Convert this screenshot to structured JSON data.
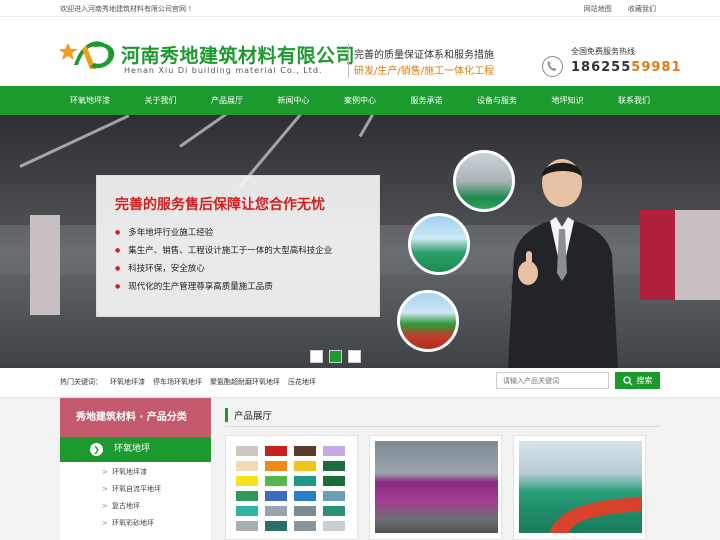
{
  "topbar": {
    "welcome": "欢迎进入河南秀地建筑材料有限公司官网 ！",
    "links": [
      "网站地图",
      "收藏我们"
    ]
  },
  "header": {
    "company_cn": "河南秀地建筑材料有限公司",
    "company_en": "Henan Xiu Di building material Co., Ltd.",
    "slogan_line1": "完善的质量保证体系和服务措施",
    "slogan_line2": "研发/生产/销售/施工一体化工程",
    "hotline_label": "全国免费服务热线",
    "hotline_main": "186255",
    "hotline_highlight": "59981"
  },
  "nav": {
    "items": [
      "环氧地坪漆",
      "关于我们",
      "产品展厅",
      "新闻中心",
      "案例中心",
      "服务承诺",
      "设备与服务",
      "地坪知识",
      "联系我们"
    ]
  },
  "banner": {
    "headline": "完善的服务售后保障让您合作无忧",
    "points": [
      "多年地坪行业施工经验",
      "集生产、销售、工程设计施工于一体的大型高科技企业",
      "科技环保，安全放心",
      "现代化的生产管理尊享高质量施工品质"
    ],
    "slide_count": 3,
    "active_slide": 2
  },
  "search": {
    "keywords_label": "热门关键词：",
    "keywords": [
      "环氧地坪漆",
      "停车场环氧地坪",
      "聚氨酯超耐磨环氧地坪",
      "压花地坪"
    ],
    "placeholder": "请输入产品关键词",
    "button_label": "搜索"
  },
  "sidebar": {
    "title": "秀地建筑材料 · 产品分类",
    "category": "环氧地坪",
    "items": [
      "环氧地坪漆",
      "环氧自流平地坪",
      "复古地坪",
      "环氧彩砂地坪"
    ]
  },
  "products": {
    "section_title": "产品展厅",
    "swatch_colors": [
      "#cfc7bf",
      "#c7201f",
      "#5b3a2d",
      "#c6a9e6",
      "#eddcb6",
      "#f08a16",
      "#f2c21e",
      "#1f6b3c",
      "#f6e21a",
      "#56b64c",
      "#1e9a84",
      "#1c6b3a",
      "#2d9a5a",
      "#3d6dbb",
      "#2a7fc8",
      "#6a9fb6",
      "#30b5a5",
      "#9aa2ac",
      "#7c8a95",
      "#2b8f7a",
      "#a9aeb3",
      "#2c6f6a",
      "#8b959e",
      "#c9ced3"
    ]
  },
  "colors": {
    "brand_green": "#1c9a2e",
    "accent_orange": "#e07a10",
    "headline_red": "#d0201e",
    "sidebar_header": "#c45a6e"
  }
}
